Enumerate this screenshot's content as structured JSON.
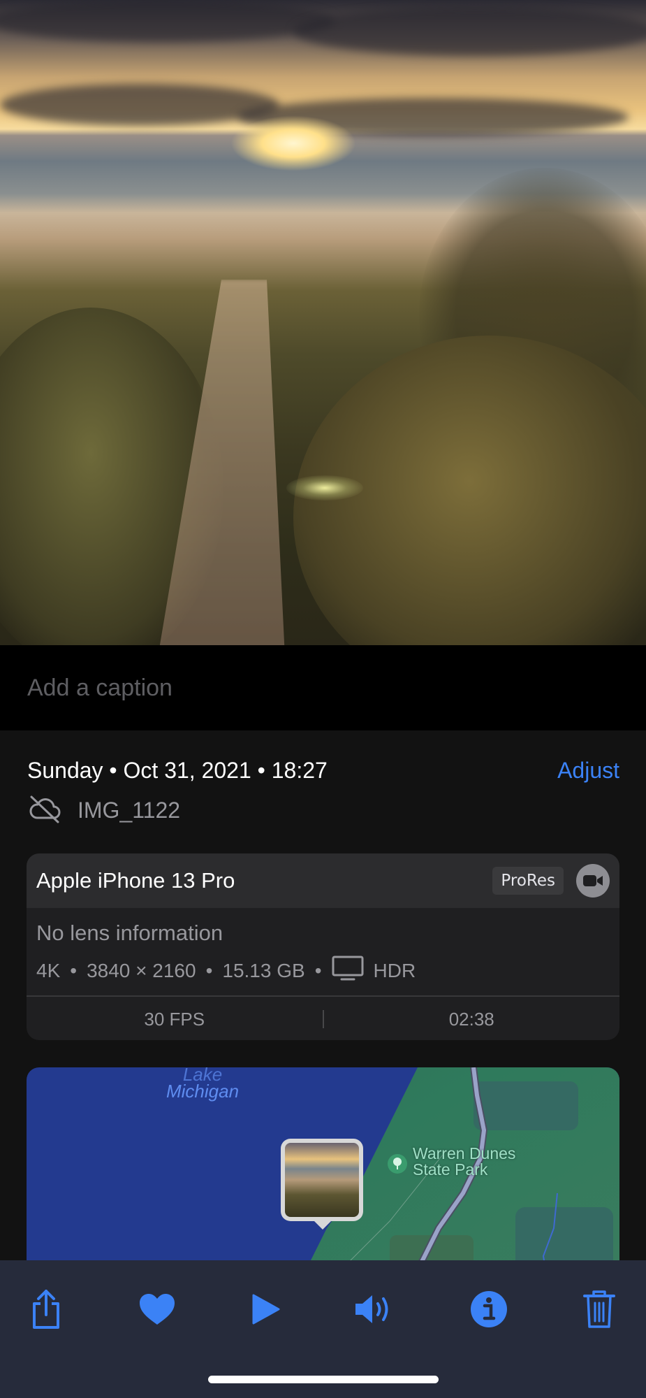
{
  "caption": {
    "placeholder": "Add a caption"
  },
  "info": {
    "datetime": "Sunday • Oct 31, 2021 • 18:27",
    "adjust_label": "Adjust",
    "filename": "IMG_1122"
  },
  "device_card": {
    "device": "Apple iPhone 13 Pro",
    "codec_badge": "ProRes",
    "lens": "No lens information",
    "resolution_label": "4K",
    "dimensions": "3840 × 2160",
    "file_size": "15.13 GB",
    "dynamic_range": "HDR",
    "fps": "30 FPS",
    "duration": "02:38"
  },
  "map": {
    "lake_label_partial": "Lake",
    "lake_label": "Michigan",
    "park_label_line1": "Warren Dunes",
    "park_label_line2": "State Park"
  },
  "toolbar": {
    "items": [
      "share-icon",
      "heart-icon",
      "play-icon",
      "speaker-icon",
      "info-icon",
      "trash-icon"
    ]
  },
  "colors": {
    "accent": "#3b82f6",
    "background": "#121212",
    "toolbar": "#262b3b"
  }
}
